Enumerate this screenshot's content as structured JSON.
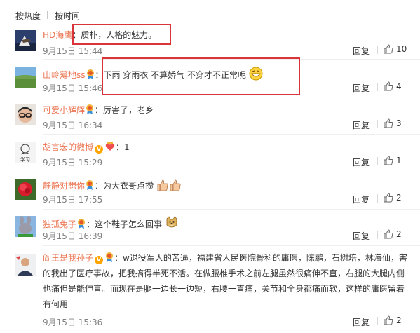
{
  "sort_tabs": [
    "按热度",
    "按时间"
  ],
  "reply_label": "回复",
  "comments": [
    {
      "name": "HD海鹰",
      "separator": "：",
      "text": "质朴，人格的魅力。",
      "time": "9月15日 15:44",
      "likes": "10"
    },
    {
      "name": "山岭薄地ss",
      "separator": "：",
      "text": "下雨 穿雨衣 不算娇气 不穿才不正常呢",
      "time": "9月15日 15:46",
      "likes": "4"
    },
    {
      "name": "可爱小辉辉",
      "separator": "：",
      "text": "厉害了，老乡",
      "time": "9月15日 16:34",
      "likes": "3"
    },
    {
      "name": "胡言宏的微博",
      "separator": "：",
      "text": "1",
      "time": "9月15日 15:29",
      "likes": "1",
      "avatar_text": "学习"
    },
    {
      "name": "静静对想你",
      "separator": "：",
      "text": "为大衣哥点攒",
      "time": "9月15日 17:55",
      "likes": "2"
    },
    {
      "name": "独孤兔子",
      "separator": "：",
      "text": "这个鞋子怎么回事",
      "time": "9月15日 16:39",
      "likes": "2"
    },
    {
      "name": "阎王是我孙子",
      "separator": "：",
      "text": "w退役军人的苦逼，福建省人民医院骨科的庸医，陈鹏，石树培，林海仙，害的我出了医疗事故，把我搞得半死不活。在做腰椎手术之前左腿虽然很痛伸不直，右腿的大腿内侧 也痛但是能伸直。而现在是腿一边长一边短，右腰一直痛，关节和全身都痛而软，这样的庸医留着有何用",
      "time": "9月15日 15:36",
      "likes": "2"
    }
  ],
  "colors": {
    "username": "#eb7350",
    "highlight": "#d9343a",
    "meta": "#808080"
  }
}
